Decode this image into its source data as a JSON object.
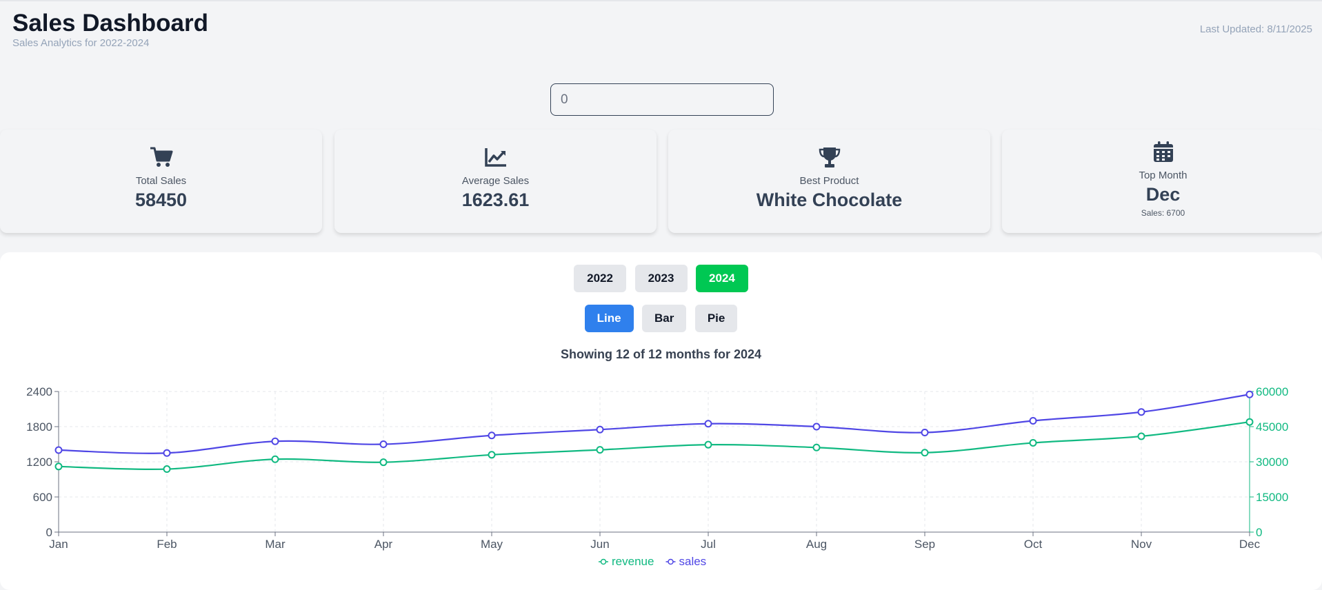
{
  "header": {
    "title": "Sales Dashboard",
    "subtitle": "Sales Analytics for 2022-2024",
    "last_updated": "Last Updated: 8/11/2025"
  },
  "search": {
    "value": "",
    "placeholder": "0"
  },
  "cards": {
    "total_sales": {
      "label": "Total Sales",
      "value": "58450",
      "icon": "shopping-cart-icon"
    },
    "average_sales": {
      "label": "Average Sales",
      "value": "1623.61",
      "icon": "chart-line-icon"
    },
    "best_product": {
      "label": "Best Product",
      "value": "White Chocolate",
      "icon": "trophy-icon"
    },
    "top_month": {
      "label": "Top Month",
      "value": "Dec",
      "extra": "Sales: 6700",
      "icon": "calendar-icon"
    }
  },
  "year_buttons": {
    "y2022": "2022",
    "y2023": "2023",
    "y2024": "2024",
    "active": "2024"
  },
  "chart_type_buttons": {
    "line": "Line",
    "bar": "Bar",
    "pie": "Pie",
    "active": "Line"
  },
  "showing_text": "Showing 12 of 12 months for 2024",
  "colors": {
    "sales": "#4f46e5",
    "revenue": "#10b981",
    "active_year": "#00c853",
    "active_type": "#2f80ed"
  },
  "chart_data": {
    "type": "line",
    "categories": [
      "Jan",
      "Feb",
      "Mar",
      "Apr",
      "May",
      "Jun",
      "Jul",
      "Aug",
      "Sep",
      "Oct",
      "Nov",
      "Dec"
    ],
    "series": [
      {
        "name": "revenue",
        "axis": "right",
        "values": [
          28000,
          26900,
          31100,
          29800,
          33000,
          35100,
          37300,
          36100,
          33900,
          38100,
          40900,
          47000
        ]
      },
      {
        "name": "sales",
        "axis": "left",
        "values": [
          1400,
          1350,
          1550,
          1500,
          1650,
          1750,
          1850,
          1800,
          1700,
          1900,
          2050,
          2350
        ]
      }
    ],
    "y_left": {
      "range": [
        0,
        2400
      ],
      "ticks": [
        "0",
        "600",
        "1200",
        "1800",
        "2400"
      ]
    },
    "y_right": {
      "range": [
        0,
        60000
      ],
      "ticks": [
        "0",
        "15000",
        "30000",
        "45000",
        "60000"
      ]
    },
    "grid": true,
    "legend": "bottom-center"
  }
}
